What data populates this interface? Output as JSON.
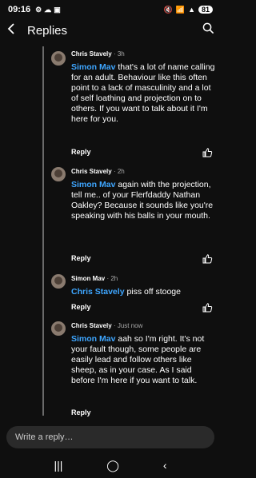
{
  "status": {
    "time": "09:16",
    "battery": "81"
  },
  "header": {
    "title": "Replies"
  },
  "comments": [
    {
      "author": "Chris Stavely",
      "time": "3h",
      "mention": "Simon Mav",
      "text": " that's a lot of name calling for an adult.  Behaviour like this often point to a lack of masculinity and a lot of self loathing and projection on to others.  If you want to talk about it I'm here for you.",
      "reply": "Reply"
    },
    {
      "author": "Chris Stavely",
      "time": "2h",
      "mention": "Simon Mav",
      "text": " again with the projection, tell me.. of your Flerfdaddy Nathan Oakley? Because it sounds like you're speaking with his balls in your mouth.",
      "reply": "Reply"
    },
    {
      "author": "Simon Mav",
      "time": "2h",
      "mention": "Chris Stavely",
      "text": " piss off stooge",
      "reply": "Reply"
    },
    {
      "author": "Chris Stavely",
      "time": "Just now",
      "mention": "Simon Mav",
      "text": " aah so I'm right.  It's not your fault though, some people are easily lead and follow others like sheep, as in your case.  As I said before I'm here if you want to talk.",
      "reply": "Reply"
    }
  ],
  "composer": {
    "placeholder": "Write a reply…"
  },
  "icons": [
    "back-arrow-icon",
    "search-icon",
    "thumbs-up-icon",
    "recents-icon",
    "home-icon",
    "back-nav-icon"
  ]
}
